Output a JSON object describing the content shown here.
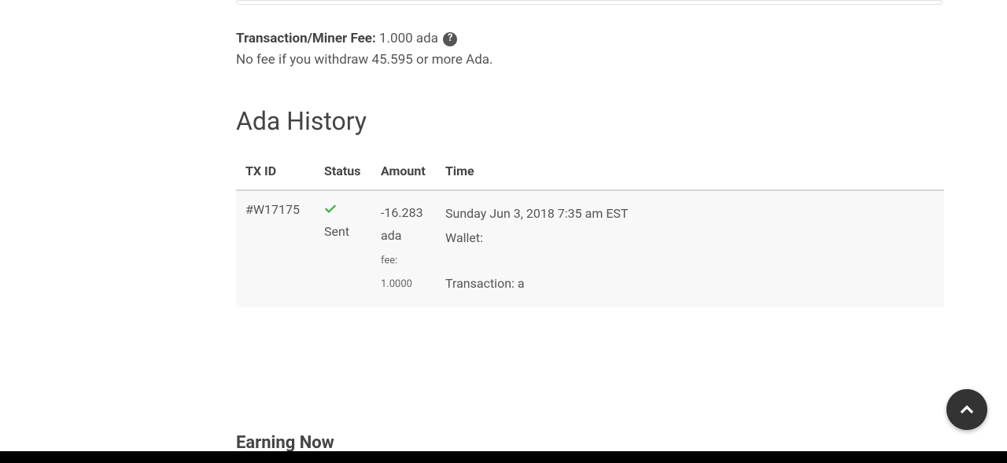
{
  "fee": {
    "label": "Transaction/Miner Fee:",
    "value": "1.000 ada",
    "note": "No fee if you withdraw 45.595 or more Ada."
  },
  "history": {
    "heading": "Ada History",
    "columns": {
      "txid": "TX ID",
      "status": "Status",
      "amount": "Amount",
      "time": "Time"
    },
    "rows": [
      {
        "txid": "#W17175",
        "status": "Sent",
        "amount_line1": "-16.283",
        "amount_line2": "ada",
        "fee_label": "fee:",
        "fee_value": "1.0000",
        "time": "Sunday Jun 3, 2018 7:35 am EST",
        "wallet_label": "Wallet:",
        "tx_label": "Transaction: a"
      }
    ]
  },
  "earning": {
    "heading": "Earning Now"
  }
}
